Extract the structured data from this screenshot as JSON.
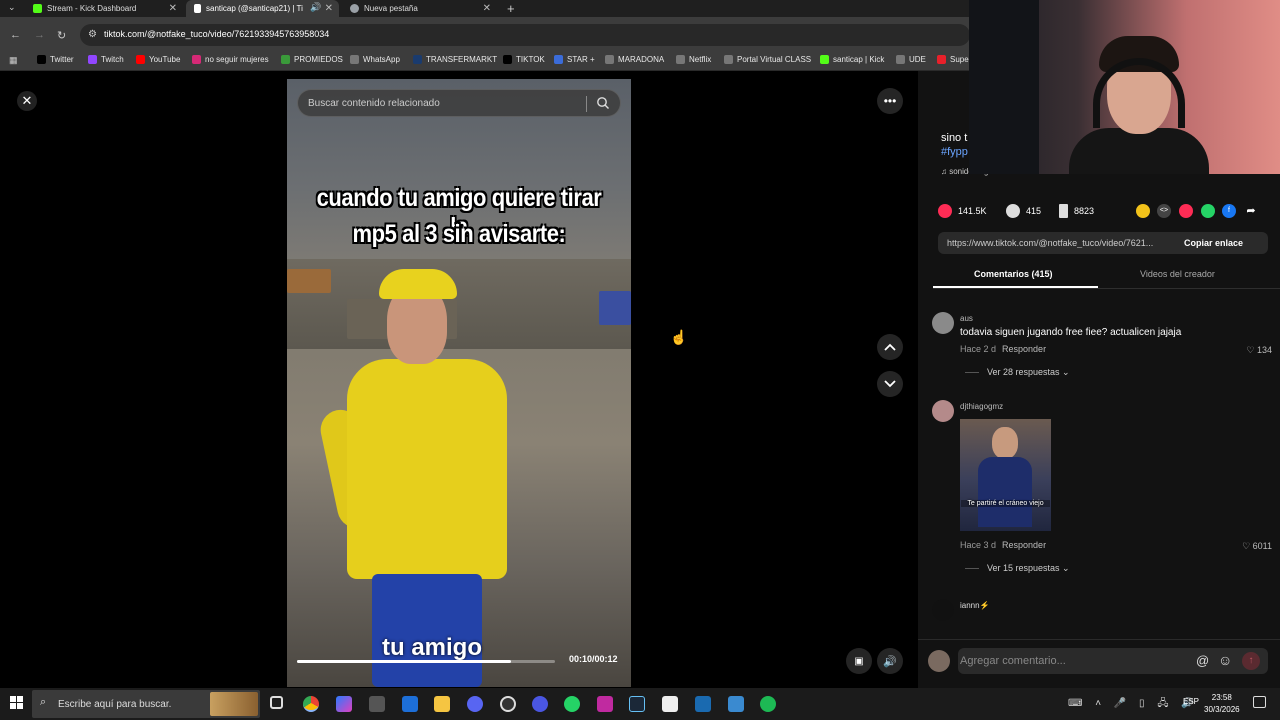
{
  "browser": {
    "tabs": [
      {
        "title": "Stream - Kick Dashboard",
        "color": "#53fc18"
      },
      {
        "title": "santicap (@santicap21) | Ti",
        "color": "#ffffff"
      },
      {
        "title": "Nueva pestaña",
        "color": "#9aa0a6"
      }
    ],
    "new_tab": "+",
    "url": "tiktok.com/@notfake_tuco/video/7621933945763958034",
    "bookmarks": [
      {
        "label": "Twitter",
        "icon": "x-icon",
        "color": "#000000"
      },
      {
        "label": "Twitch",
        "icon": "twitch-icon",
        "color": "#9146ff"
      },
      {
        "label": "YouTube",
        "icon": "youtube-icon",
        "color": "#ff0000"
      },
      {
        "label": "no seguir mujeres",
        "icon": "instagram-icon",
        "color": "#d62976"
      },
      {
        "label": "PROMIEDOS",
        "icon": "leaf-icon",
        "color": "#3a9a3a"
      },
      {
        "label": "WhatsApp",
        "icon": "globe-icon",
        "color": "#777777"
      },
      {
        "label": "TRANSFERMARKT",
        "icon": "tm-icon",
        "color": "#1a3b6e"
      },
      {
        "label": "TIKTOK",
        "icon": "tiktok-icon",
        "color": "#000000"
      },
      {
        "label": "STAR +",
        "icon": "star-icon",
        "color": "#3b6cd9"
      },
      {
        "label": "MARADONA",
        "icon": "globe-icon",
        "color": "#777777"
      },
      {
        "label": "Netflix",
        "icon": "globe-icon",
        "color": "#777777"
      },
      {
        "label": "Portal Virtual CLASS",
        "icon": "globe-icon",
        "color": "#777777"
      },
      {
        "label": "santicap | Kick",
        "icon": "kick-icon",
        "color": "#53fc18"
      },
      {
        "label": "UDE",
        "icon": "globe-icon",
        "color": "#777777"
      },
      {
        "label": "Super",
        "icon": "super-icon",
        "color": "#e8202a"
      }
    ]
  },
  "video": {
    "search_placeholder": "Buscar contenido relacionado",
    "caption_line1": "cuando tu amigo quiere tirar la",
    "caption_line2": "mp5 al 3 sin avisarte:",
    "subtitle": "tu amigo",
    "time": "00:10/00:12",
    "progress": 0.83
  },
  "panel": {
    "desc_line1": "sino t",
    "desc_line2": "#fypp",
    "sound": "sonido original - Tuco??",
    "likes": "141.5K",
    "comments_count": "415",
    "saves": "8823",
    "link": "https://www.tiktok.com/@notfake_tuco/video/7621...",
    "copy_label": "Copiar enlace",
    "tab_comments": "Comentarios (415)",
    "tab_creator": "Videos del creador",
    "comments": [
      {
        "user": "aus",
        "text": "todavia siguen jugando free fiee? actualicen jajaja",
        "time": "Hace 2 d",
        "reply": "Responder",
        "likes": "134",
        "more": "Ver 28 respuestas"
      },
      {
        "user": "djthiagogmz",
        "image_caption": "Te partiré el cráneo viejo",
        "time": "Hace 3 d",
        "reply": "Responder",
        "likes": "6011",
        "more": "Ver 15 respuestas"
      },
      {
        "user": "iannn⚡"
      }
    ],
    "comment_placeholder": "Agregar comentario..."
  },
  "taskbar": {
    "search_placeholder": "Escribe aquí para buscar.",
    "lang": "ESP",
    "time": "23:58",
    "date": "30/3/2026"
  }
}
